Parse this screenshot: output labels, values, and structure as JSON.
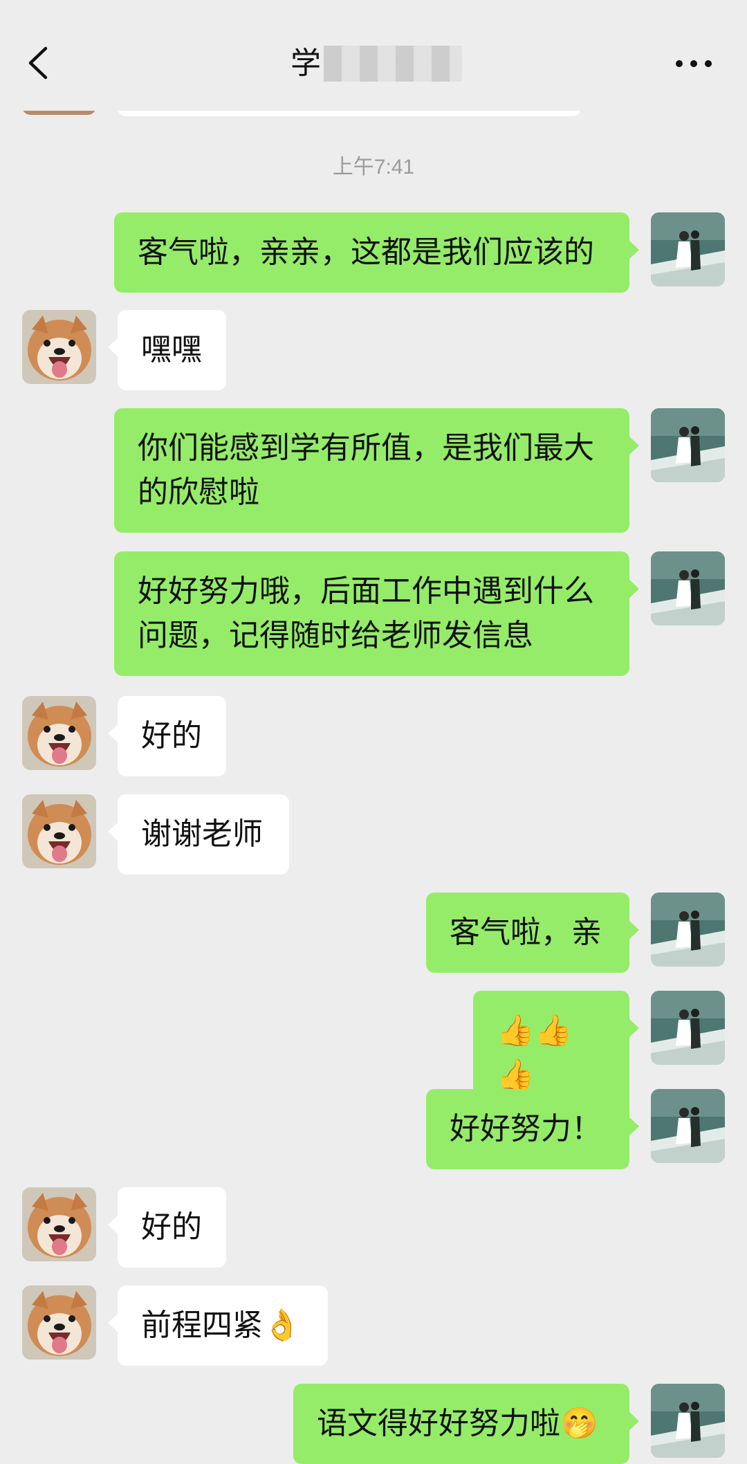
{
  "header": {
    "title_visible": "学",
    "back_icon": "chevron-left-icon",
    "more_icon": "more-dots-icon"
  },
  "timestamp": "上午7:41",
  "messages": [
    {
      "side": "me",
      "text": "客气啦，亲亲，这都是我们应该的"
    },
    {
      "side": "them",
      "text": "嘿嘿"
    },
    {
      "side": "me",
      "text": "你们能感到学有所值，是我们最大\n的欣慰啦"
    },
    {
      "side": "me",
      "text": "好好努力哦，后面工作中遇到什么\n问题，记得随时给老师发信息"
    },
    {
      "side": "them",
      "text": "好的"
    },
    {
      "side": "them",
      "text": "谢谢老师"
    },
    {
      "side": "me",
      "text": "客气啦，亲"
    },
    {
      "side": "me",
      "text": "👍👍👍"
    },
    {
      "side": "me",
      "text": "好好努力！"
    },
    {
      "side": "them",
      "text": "好的"
    },
    {
      "side": "them",
      "text": "前程四紧👌"
    },
    {
      "side": "me",
      "text": "语文得好好努力啦🤭"
    }
  ],
  "colors": {
    "background": "#ededed",
    "my_bubble": "#95ec69",
    "their_bubble": "#ffffff",
    "timestamp_text": "#9b9b9b"
  },
  "avatars": {
    "me": "couple-photo-avatar",
    "them": "shiba-dog-avatar"
  }
}
